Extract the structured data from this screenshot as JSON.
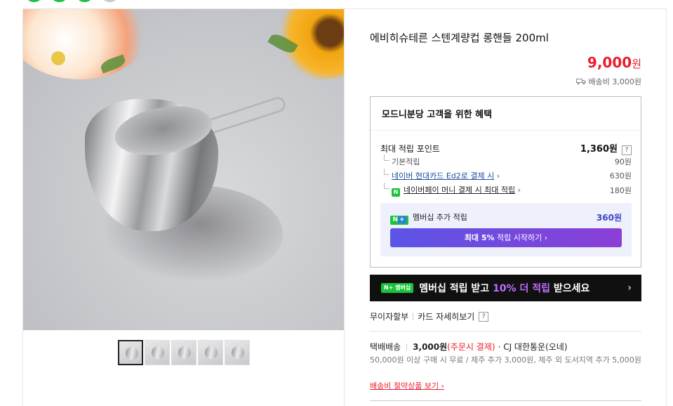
{
  "product": {
    "title": "에비히슈테른 스텐계량컵 롱핸들 200ml",
    "price": "9,000",
    "price_unit": "원",
    "shipping_fee_label": "배송비 3,000원"
  },
  "benefits": {
    "title": "모드니분당 고객을 위한 혜택",
    "max_points_label": "최대 적립 포인트",
    "max_points_value": "1,360원",
    "help_icon": "?",
    "items": [
      {
        "label": "기본적립",
        "value": "90원"
      },
      {
        "label": "네이버 현대카드 Ed2로 결제 시",
        "value": "630원"
      },
      {
        "label": "네이버페이 머니 결제 시 최대 적립",
        "value": "180원"
      }
    ],
    "membership_label": "멤버십 추가 적립",
    "membership_value": "360원",
    "membership_button": {
      "bold": "최대 5%",
      "rest": " 적립 시작하기 ›"
    }
  },
  "banner": {
    "badge": "N+ 멤버십",
    "text_before": "멤버십 적립 받고 ",
    "highlight": "10% 더 적립",
    "text_after": " 받으세요",
    "chevron": "›"
  },
  "payment": {
    "interest_free": "무이자할부",
    "card_detail": "카드 자세히보기",
    "help_icon": "?"
  },
  "shipping": {
    "method": "택배배송",
    "fee": "3,000원",
    "fee_note": "(주문시 결제)",
    "carrier": "· CJ 대한통운(오네)",
    "condition": "50,000원 이상 구매 시 무료 / 제주 추가 3,000원, 제주 외 도서지역 추가 5,000원",
    "saving_link": "배송비 절약상품 보기 ›"
  },
  "colors": {
    "price_red": "#ea1d2c",
    "naver_green": "#19c33a",
    "member_purple": "#5b54e6"
  }
}
